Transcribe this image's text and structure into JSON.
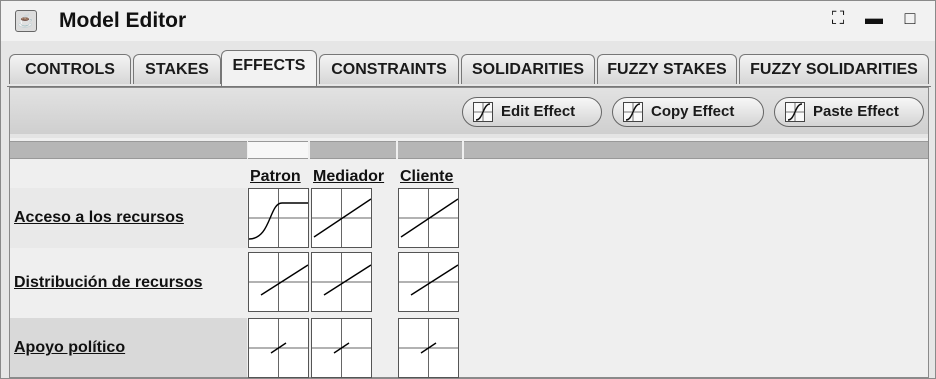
{
  "window": {
    "title": "Model Editor",
    "app_icon": "java-cup-icon",
    "controls": [
      "restore-icon",
      "minimize-icon",
      "maximize-icon"
    ]
  },
  "tabs": [
    {
      "label": "CONTROLS",
      "active": false
    },
    {
      "label": "STAKES",
      "active": false
    },
    {
      "label": "EFFECTS",
      "active": true
    },
    {
      "label": "CONSTRAINTS",
      "active": false
    },
    {
      "label": "SOLIDARITIES",
      "active": false
    },
    {
      "label": "FUZZY STAKES",
      "active": false
    },
    {
      "label": "FUZZY SOLIDARITIES",
      "active": false
    }
  ],
  "toolbar": {
    "edit_label": "Edit Effect",
    "copy_label": "Copy Effect",
    "paste_label": "Paste Effect",
    "icon": "function-curve-icon"
  },
  "grid": {
    "columns": [
      "Patron",
      "Mediador",
      "Cliente"
    ],
    "rows": [
      {
        "label": "Acceso a los recursos",
        "effects": [
          "sigmoid",
          "linear",
          "linear"
        ]
      },
      {
        "label": "Distribución de recursos",
        "effects": [
          "linear",
          "linear",
          "linear"
        ]
      },
      {
        "label": "Apoyo político",
        "effects": [
          "short-linear",
          "short-linear",
          "short-linear"
        ]
      }
    ]
  }
}
